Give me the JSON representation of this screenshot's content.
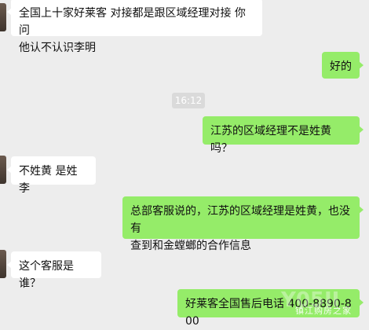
{
  "messages": [
    {
      "side": "in",
      "text": "全国上十家好莱客 对接都是跟区域经理对接 你问\n他认不认识李明"
    },
    {
      "side": "out",
      "text": "好的"
    },
    {
      "side": "out",
      "text": "江苏的区域经理不是姓黄吗？"
    },
    {
      "side": "in",
      "text": "不姓黄 是姓李"
    },
    {
      "side": "out",
      "text": "总部客服说的，江苏的区域经理是姓黄，也没有\n查到和金螳螂的合作信息"
    },
    {
      "side": "in",
      "text": "这个客服是谁？"
    },
    {
      "side": "out",
      "text": "好莱客全国售后电话 400-8890-800"
    }
  ],
  "timestamp": "16:12",
  "watermark": {
    "logo": "Y05II",
    "text": "镇江购房之家"
  }
}
